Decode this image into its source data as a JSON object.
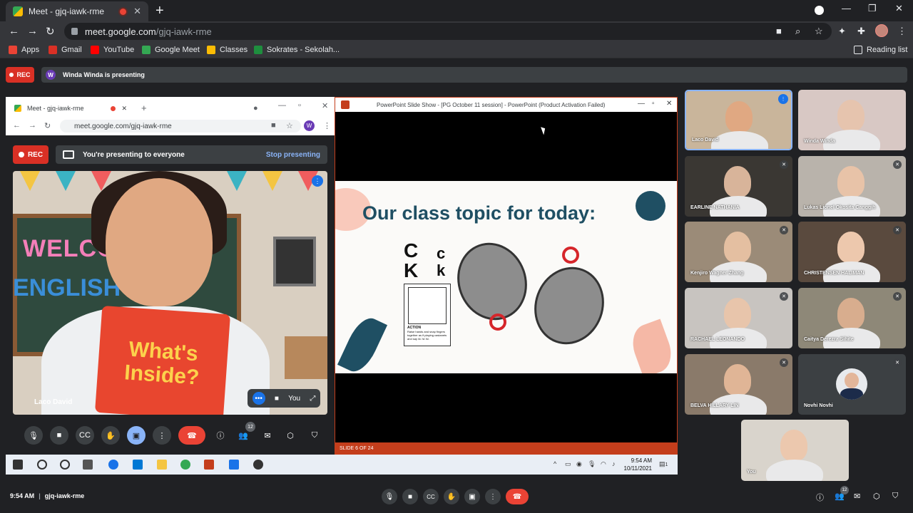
{
  "browser": {
    "tab_title": "Meet - gjq-iawk-rme",
    "tab_close": "✕",
    "new_tab": "+",
    "url_host": "meet.google.com",
    "url_path": "/gjq-iawk-rme",
    "bookmarks": [
      {
        "label": "Apps",
        "color": "#ea4335"
      },
      {
        "label": "Gmail",
        "color": "#d93025"
      },
      {
        "label": "YouTube",
        "color": "#ff0000"
      },
      {
        "label": "Google Meet",
        "color": "#34a853"
      },
      {
        "label": "Classes",
        "color": "#fbbc04"
      },
      {
        "label": "Sokrates - Sekolah...",
        "color": "#1e8e3e"
      }
    ],
    "reading_list": "Reading list"
  },
  "meet": {
    "rec_label": "REC",
    "presenter_initial": "W",
    "presenting_text": "Winda Winda is presenting",
    "time": "9:54 AM",
    "separator": "|",
    "meeting_code": "gjq-iawk-rme",
    "participants_count": "12"
  },
  "shared_screen": {
    "inner_tab_title": "Meet - gjq-iawk-rme",
    "inner_url": "meet.google.com/gjq-iawk-rme",
    "inner_avatar": "W",
    "rec_label": "REC",
    "presenting_banner": "You're presenting to everyone",
    "stop_presenting": "Stop presenting",
    "main_name": "Laco David",
    "you_label": "You",
    "book_text_1": "What's",
    "book_text_2": "Inside?",
    "welcome_text": "WELCO",
    "english_text": "ENGLISH     SS!",
    "participants_count": "12",
    "ppt_title": "PowerPoint Slide Show - [PG October 11 session] - PowerPoint (Product Activation Failed)",
    "slide_title": "Our class topic for today:",
    "letters_big": [
      "C",
      "K"
    ],
    "letters_small": [
      "c",
      "k"
    ],
    "card_title": "ACTION",
    "card_text": "Raise hands and snap fingers together as if playing castanets and say /k/ /k/ /k/.",
    "slide_status": "SLIDE 6 OF 24",
    "taskbar_time": "9:54 AM",
    "taskbar_date": "10/11/2021",
    "notif_count": "1"
  },
  "participants": [
    {
      "name": "Laco David",
      "bg": "#c9b59b",
      "skin": "#e0a882",
      "active": true,
      "speaking": true
    },
    {
      "name": "Winda Winda",
      "bg": "#d8c8c4",
      "skin": "#e6c4ae",
      "active": false,
      "speaking": false
    },
    {
      "name": "EARLINE NATHANIA",
      "bg": "#3a3733",
      "skin": "#d8b49a",
      "muted": true
    },
    {
      "name": "Lukas Lionel Okosita Canggih",
      "bg": "#b9b3ab",
      "skin": "#e8c3a8",
      "muted": true
    },
    {
      "name": "Kenjiro Wagner Zhang",
      "bg": "#9b8b78",
      "skin": "#e4bfa1",
      "muted": true
    },
    {
      "name": "CHRISTENSEN HALIMAN",
      "bg": "#5a4a3e",
      "skin": "#edc8ad",
      "muted": true
    },
    {
      "name": "RACHAEL LEONANDO",
      "bg": "#c8c4c0",
      "skin": "#e8c5ab",
      "muted": true
    },
    {
      "name": "Caitya Derezra Sihite",
      "bg": "#8e8878",
      "skin": "#d8ad8e",
      "muted": true
    },
    {
      "name": "BELVA HILLARY LIN",
      "bg": "#8a7a6a",
      "skin": "#e0b596",
      "muted": true
    },
    {
      "name": "Novhi Novhi",
      "avatar": true,
      "muted": true
    },
    {
      "name": "You",
      "bg": "#d9d4cc",
      "skin": "#ecc8ae",
      "muted": false
    }
  ],
  "colors": {
    "meet_bg": "#202124",
    "control_bg": "#3c4043",
    "hangup": "#ea4335",
    "accent_blue": "#8ab4f8",
    "ppt_orange": "#c43e1c",
    "slide_title": "#1f4f63"
  },
  "icons": {
    "mute": "🎙",
    "mic_off": "✕"
  }
}
